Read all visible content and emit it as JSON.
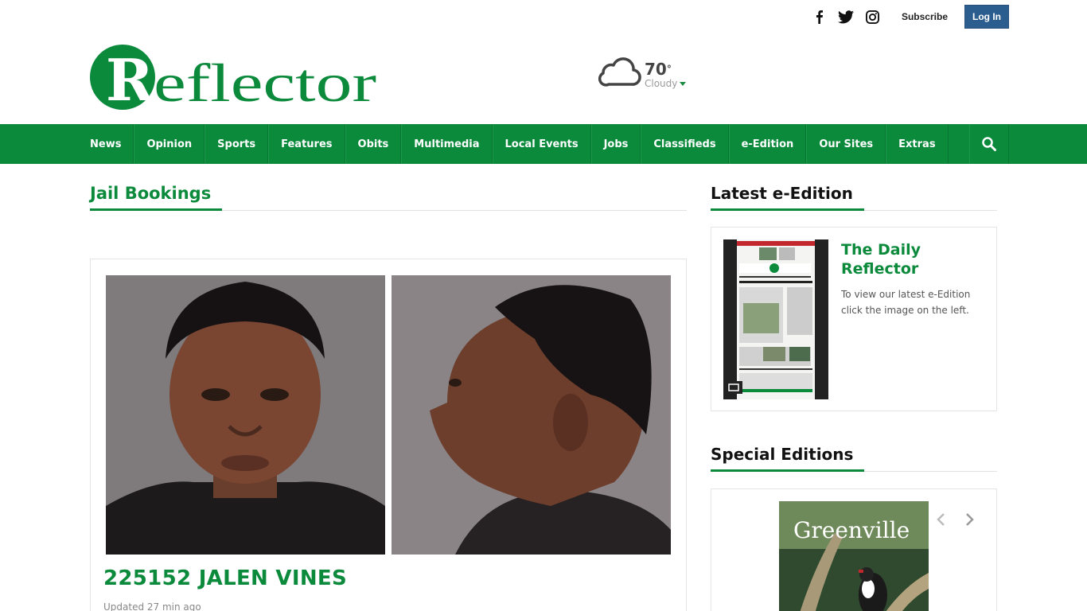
{
  "header": {
    "social": [
      "facebook-icon",
      "twitter-icon",
      "instagram-icon"
    ],
    "subscribe_label": "Subscribe",
    "login_label": "Log In",
    "logo_text": "Reflector"
  },
  "weather": {
    "temp": "70",
    "degree": "°",
    "condition": "Cloudy",
    "icon": "cloud-icon"
  },
  "nav": {
    "items": [
      "News",
      "Opinion",
      "Sports",
      "Features",
      "Obits",
      "Multimedia",
      "Local Events",
      "Jobs",
      "Classifieds",
      "e-Edition",
      "Our Sites",
      "Extras"
    ],
    "search_icon": "search-icon"
  },
  "main": {
    "section_title": "Jail Bookings",
    "article": {
      "title": "225152 JALEN VINES",
      "updated": "Updated 27 min ago"
    }
  },
  "sidebar": {
    "latest_title": "Latest e-Edition",
    "edition": {
      "title": "The Daily Reflector",
      "description": "To view our latest e-Edition click the image on the left."
    },
    "special_title": "Special Editions",
    "special_cover_text": "Greenville"
  },
  "colors": {
    "brand_green": "#0b8a3c",
    "login_blue": "#2c5d8f"
  }
}
